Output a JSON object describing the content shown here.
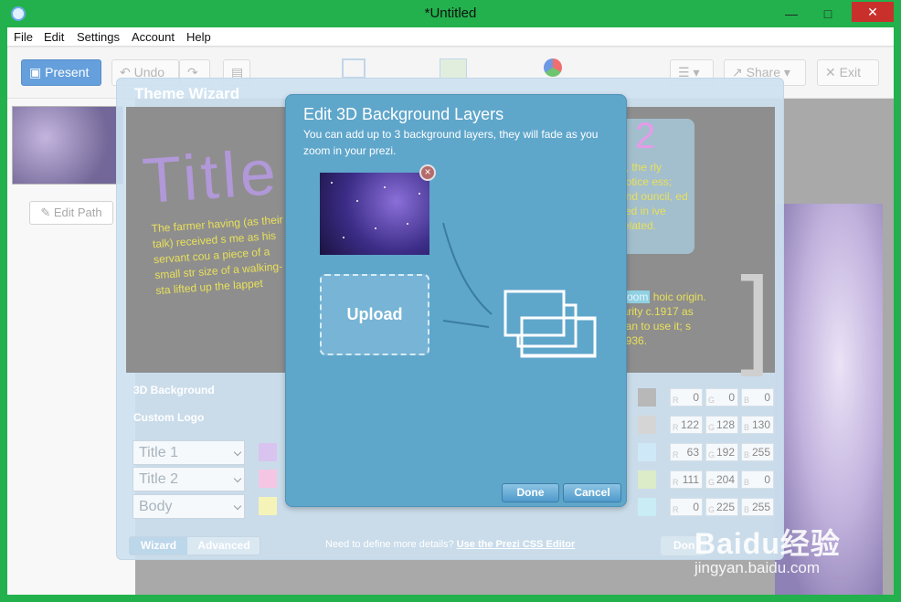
{
  "window": {
    "title": "*Untitled",
    "minimize": "—",
    "maximize": "□",
    "close": "✕"
  },
  "menu": [
    "File",
    "Edit",
    "Settings",
    "Account",
    "Help"
  ],
  "toolbar": {
    "present": "Present",
    "undo": "Undo",
    "share": "Share",
    "exit": "Exit"
  },
  "sidebar": {
    "edit_path": "Edit Path"
  },
  "theme_wizard": {
    "title": "Theme Wizard",
    "preview_title": "Title",
    "preview_text": "The farmer having (as their talk) received s me as his servant cou a piece of a small str size of a walking-sta lifted up the lappet",
    "preview_right_text": "g, the rly notice ess; and ouncil, ed tied in ive related.",
    "preview_right_text2_highlight": "zoom",
    "preview_right_text2": "hoic origin. larity c.1917 as gan to use it; s 1936.",
    "label_3d_bg": "3D Background",
    "label_custom_logo": "Custom Logo",
    "fonts": [
      "Title 1",
      "Title 2",
      "Body"
    ],
    "left_swatches": [
      "#d9c4ef",
      "#f5c6e3",
      "#f5f3b8"
    ],
    "right_swatches": [
      "#b8b8b8",
      "#d5d5d5",
      "#cfe8f7",
      "#dcebc8",
      "#c9ecf5"
    ],
    "rgb_rows": [
      [
        "0",
        "0",
        "0"
      ],
      [
        "122",
        "128",
        "130"
      ],
      [
        "63",
        "192",
        "255"
      ],
      [
        "111",
        "204",
        "0"
      ],
      [
        "0",
        "225",
        "255"
      ]
    ],
    "rgb_keys": [
      "R",
      "G",
      "B"
    ],
    "s_suffix": "s",
    "wizard_tab": "Wizard",
    "advanced_tab": "Advanced",
    "need_more": "Need to define more details?",
    "css_link": "Use the Prezi CSS Editor",
    "done_bg": "Don"
  },
  "dialog": {
    "title": "Edit 3D Background Layers",
    "description": "You can add up to 3 background layers, they will fade as you zoom in your prezi.",
    "remove_icon": "×",
    "upload": "Upload",
    "done": "Done",
    "cancel": "Cancel"
  },
  "watermark": {
    "brand": "Baidu经验",
    "url": "jingyan.baidu.com"
  }
}
